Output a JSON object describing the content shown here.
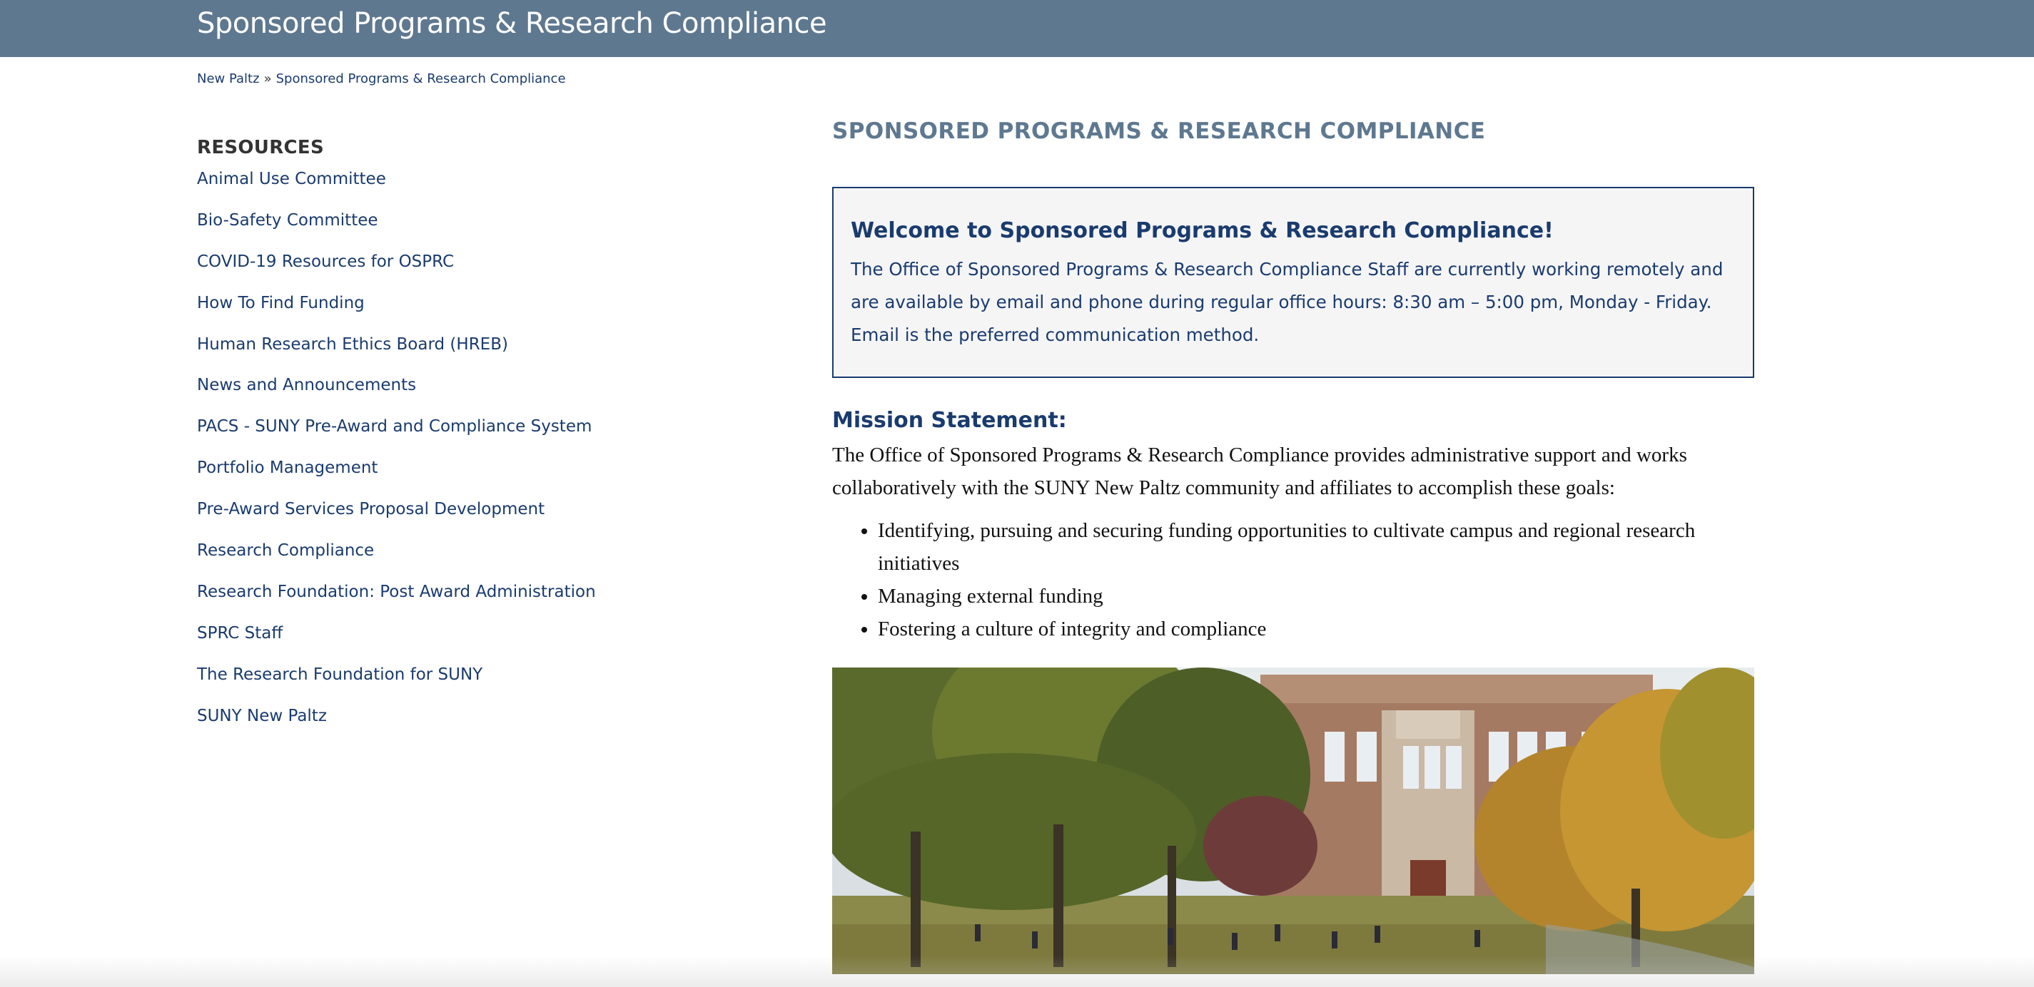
{
  "header": {
    "site_title": "Sponsored Programs & Research Compliance"
  },
  "breadcrumb": {
    "items": [
      "New Paltz",
      "Sponsored Programs & Research Compliance"
    ],
    "separator": "»"
  },
  "sidebar": {
    "heading": "RESOURCES",
    "items": [
      {
        "label": "Animal Use Committee"
      },
      {
        "label": "Bio-Safety Committee"
      },
      {
        "label": "COVID-19 Resources for OSPRC"
      },
      {
        "label": "How To Find Funding"
      },
      {
        "label": "Human Research Ethics Board (HREB)"
      },
      {
        "label": "News and Announcements"
      },
      {
        "label": "PACS - SUNY Pre-Award and Compliance System"
      },
      {
        "label": "Portfolio Management"
      },
      {
        "label": "Pre-Award Services Proposal Development"
      },
      {
        "label": "Research Compliance"
      },
      {
        "label": "Research Foundation: Post Award Administration"
      },
      {
        "label": "SPRC Staff"
      },
      {
        "label": "The Research Foundation for SUNY"
      },
      {
        "label": "SUNY New Paltz"
      }
    ]
  },
  "main": {
    "page_heading": "SPONSORED PROGRAMS & RESEARCH COMPLIANCE",
    "welcome": {
      "title": "Welcome to Sponsored Programs & Research Compliance!",
      "body": "The Office of Sponsored Programs & Research Compliance Staff are currently working remotely and are available by email and phone during regular office hours: 8:30 am – 5:00 pm, Monday - Friday.  Email is the preferred communication method."
    },
    "mission": {
      "title": "Mission Statement:",
      "body": "The Office of Sponsored Programs & Research Compliance provides administrative support and works collaboratively with the SUNY New Paltz community and affiliates to accomplish these goals:",
      "goals": [
        "Identifying, pursuing and securing funding opportunities to cultivate campus and regional research initiatives",
        "Managing external funding",
        "Fostering a culture of integrity and compliance"
      ]
    }
  },
  "colors": {
    "header_bar": "#5e7890",
    "link": "#1a3b6e",
    "box_border": "#1a3b6e",
    "heading_slate": "#5e7890"
  }
}
